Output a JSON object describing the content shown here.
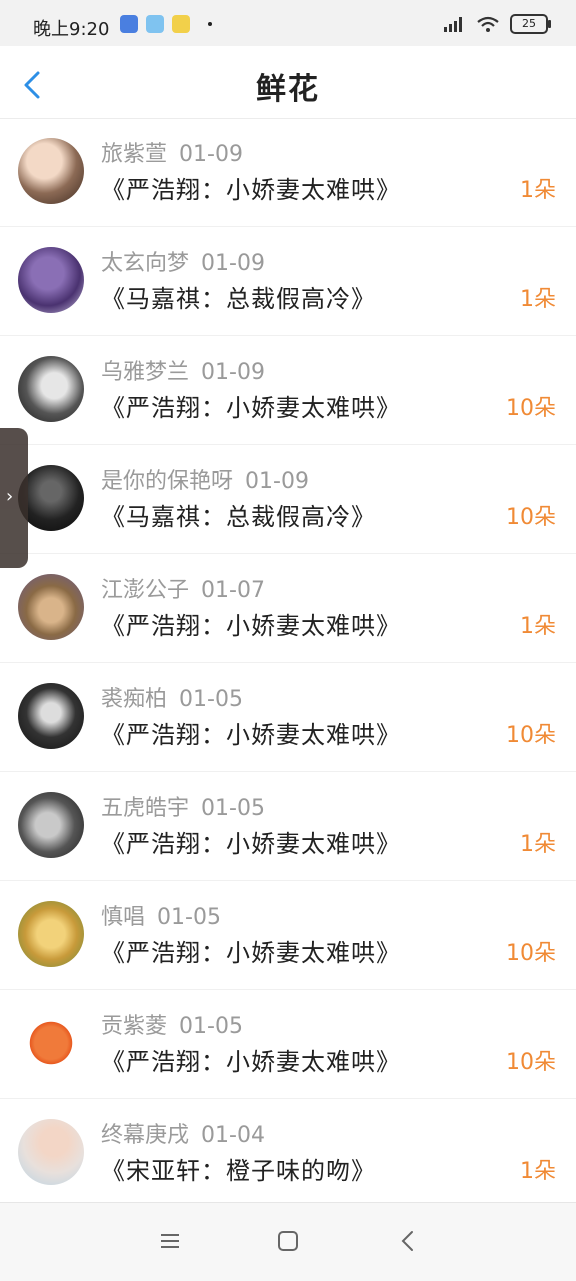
{
  "status_bar": {
    "time": "晚上9:20",
    "battery": "25"
  },
  "header": {
    "title": "鲜花"
  },
  "items": [
    {
      "name": "旅紫萱",
      "date": "01-09",
      "book": "《严浩翔：小娇妻太难哄》",
      "count": "1朵"
    },
    {
      "name": "太玄向梦",
      "date": "01-09",
      "book": "《马嘉祺：总裁假高冷》",
      "count": "1朵"
    },
    {
      "name": "乌雅梦兰",
      "date": "01-09",
      "book": "《严浩翔：小娇妻太难哄》",
      "count": "10朵"
    },
    {
      "name": "是你的保艳呀",
      "date": "01-09",
      "book": "《马嘉祺：总裁假高冷》",
      "count": "10朵"
    },
    {
      "name": "江澎公子",
      "date": "01-07",
      "book": "《严浩翔：小娇妻太难哄》",
      "count": "1朵"
    },
    {
      "name": "裘痴柏",
      "date": "01-05",
      "book": "《严浩翔：小娇妻太难哄》",
      "count": "10朵"
    },
    {
      "name": "五虎皓宇",
      "date": "01-05",
      "book": "《严浩翔：小娇妻太难哄》",
      "count": "1朵"
    },
    {
      "name": "慎唱",
      "date": "01-05",
      "book": "《严浩翔：小娇妻太难哄》",
      "count": "10朵"
    },
    {
      "name": "贡紫菱",
      "date": "01-05",
      "book": "《严浩翔：小娇妻太难哄》",
      "count": "10朵"
    },
    {
      "name": "终幕庚戌",
      "date": "01-04",
      "book": "《宋亚轩：橙子味的吻》",
      "count": "1朵"
    }
  ],
  "colors": {
    "accent": "#2d8fe6",
    "count": "#f08a35",
    "meta": "#9a9a9a"
  }
}
